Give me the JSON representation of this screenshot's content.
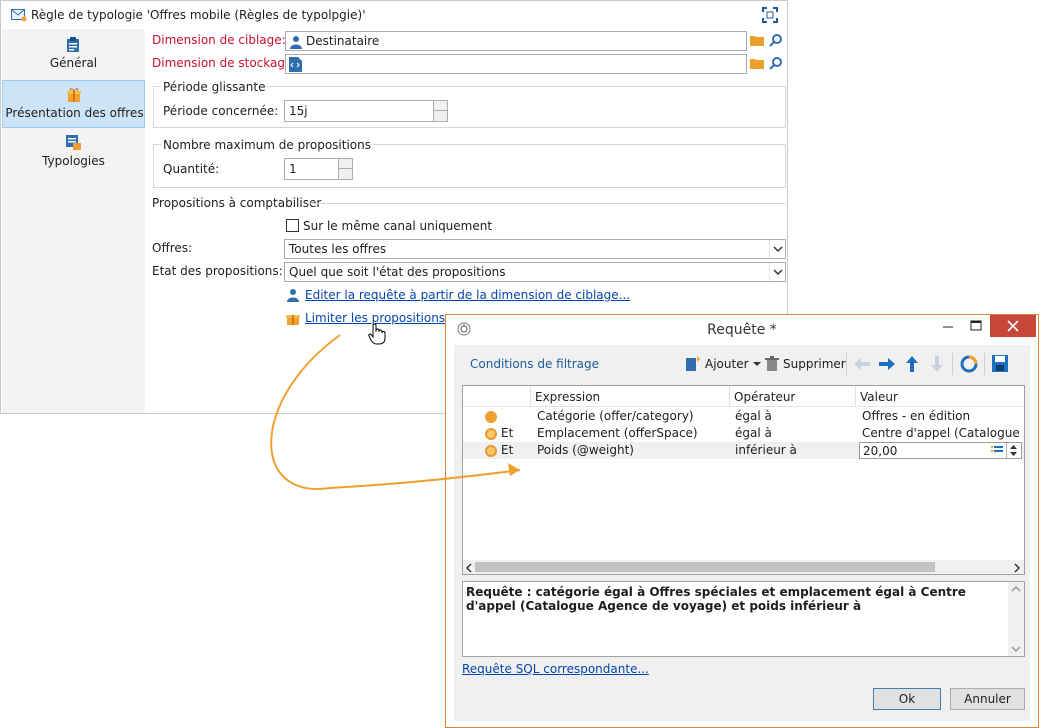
{
  "main_window": {
    "title": "Règle de typologie 'Offres mobile (Règles de typolpgie)'",
    "sidebar": [
      {
        "label": "Général",
        "icon": "clipboard-icon",
        "selected": false
      },
      {
        "label": "Présentation des offres",
        "icon": "gift-icon",
        "selected": true
      },
      {
        "label": "Typologies",
        "icon": "typology-icon",
        "selected": false
      }
    ],
    "fields": {
      "targeting_label": "Dimension de ciblage:",
      "targeting_value": "Destinataire",
      "storage_label": "Dimension de stockage:",
      "storage_value": ""
    },
    "sliding_period": {
      "title": "Période glissante",
      "label": "Période concernée:",
      "value": "15j"
    },
    "max_proposals": {
      "title": "Nombre maximum de propositions",
      "label": "Quantité:",
      "value": "1"
    },
    "proposals": {
      "title": "Propositions à comptabiliser",
      "same_channel_label": "Sur le même canal uniquement",
      "same_channel_checked": false,
      "offers_label": "Offres:",
      "offers_value": "Toutes les offres",
      "state_label": "Etat des propositions:",
      "state_value": "Quel que soit l'état des propositions",
      "edit_query_link": "Editer la requête à partir de la dimension de ciblage...",
      "limit_link": "Limiter les propositions..."
    }
  },
  "dialog": {
    "title": "Requête *",
    "toolbar": {
      "title": "Conditions de filtrage",
      "add_label": "Ajouter",
      "delete_label": "Supprimer"
    },
    "columns": [
      "Expression",
      "Opérateur",
      "Valeur"
    ],
    "rows": [
      {
        "conj": "",
        "expression": "Catégorie (offer/category)",
        "operator": "égal à",
        "value": "Offres - en édition"
      },
      {
        "conj": "Et",
        "expression": "Emplacement (offerSpace)",
        "operator": "égal à",
        "value": "Centre d'appel (Catalogue Age"
      },
      {
        "conj": "Et",
        "expression": "Poids (@weight)",
        "operator": "inférieur à",
        "value": "20,00"
      }
    ],
    "description": "Requête : catégorie égal à Offres spéciales et emplacement égal à Centre d'appel (Catalogue Agence de voyage) et poids inférieur à",
    "sql_link": "Requête SQL correspondante...",
    "ok_label": "Ok",
    "cancel_label": "Annuler"
  },
  "colors": {
    "required_label": "#c8102e",
    "link": "#0645ad",
    "selection": "#cce4f7",
    "annotation_arrow": "#f0a030",
    "close_button": "#c8473b"
  }
}
